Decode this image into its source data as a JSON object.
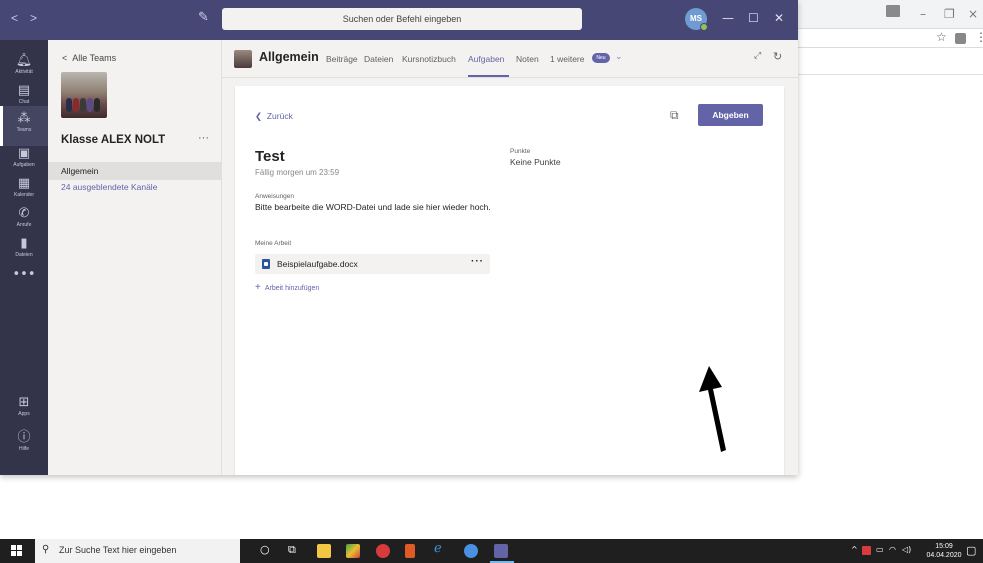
{
  "search": {
    "placeholder": "Suchen oder Befehl eingeben"
  },
  "user": {
    "initials": "MS"
  },
  "rail": {
    "items": [
      {
        "label": "Aktivität",
        "icon": "bell-icon"
      },
      {
        "label": "Chat",
        "icon": "chat-icon"
      },
      {
        "label": "Teams",
        "icon": "teams-icon"
      },
      {
        "label": "Aufgaben",
        "icon": "assignments-icon"
      },
      {
        "label": "Kalender",
        "icon": "calendar-icon"
      },
      {
        "label": "Anrufe",
        "icon": "phone-icon"
      },
      {
        "label": "Dateien",
        "icon": "files-icon"
      },
      {
        "label": "Apps",
        "icon": "apps-icon"
      },
      {
        "label": "Hilfe",
        "icon": "help-icon"
      }
    ]
  },
  "teams_panel": {
    "back_label": "Alle Teams",
    "team_name": "Klasse ALEX NOLT",
    "channels": [
      {
        "label": "Allgemein"
      },
      {
        "label": "24 ausgeblendete Kanäle"
      }
    ]
  },
  "channel": {
    "title": "Allgemein",
    "tabs": [
      {
        "label": "Beiträge"
      },
      {
        "label": "Dateien"
      },
      {
        "label": "Kursnotizbuch"
      },
      {
        "label": "Aufgaben"
      },
      {
        "label": "Noten"
      },
      {
        "label": "1 weitere"
      }
    ],
    "new_badge": "Neu"
  },
  "assignment": {
    "back_label": "Zurück",
    "submit_label": "Abgeben",
    "title": "Test",
    "due": "Fällig morgen um 23:59",
    "points_label": "Punkte",
    "points_value": "Keine Punkte",
    "instructions_label": "Anweisungen",
    "instructions_text": "Bitte bearbeite die WORD-Datei und lade sie hier wieder hoch.",
    "my_work_label": "Meine Arbeit",
    "file_name": "Beispielaufgabe.docx",
    "add_work_label": "Arbeit hinzufügen"
  },
  "taskbar": {
    "search_text": "Zur Suche Text hier eingeben",
    "time": "15:09",
    "date": "04.04.2020"
  },
  "colors": {
    "accent": "#6264a7",
    "titlebar": "#464775",
    "rail": "#33344a"
  }
}
